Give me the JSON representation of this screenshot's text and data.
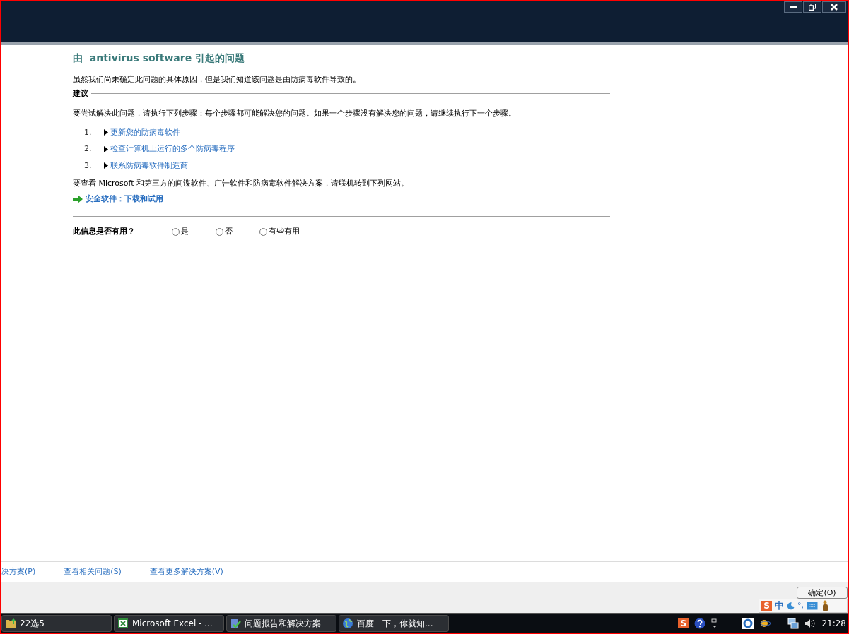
{
  "content": {
    "title": "由  antivirus software 引起的问题",
    "intro": "虽然我们尚未确定此问题的具体原因，但是我们知道该问题是由防病毒软件导致的。",
    "section_heading": "建议",
    "instructions": "要尝试解决此问题，请执行下列步骤：每个步骤都可能解决您的问题。如果一个步骤没有解决您的问题，请继续执行下一个步骤。",
    "steps": [
      {
        "number": "1.",
        "label": "更新您的防病毒软件"
      },
      {
        "number": "2.",
        "label": "检查计算机上运行的多个防病毒程序"
      },
      {
        "number": "3.",
        "label": "联系防病毒软件制造商"
      }
    ],
    "online_note": "要查看 Microsoft 和第三方的间谍软件、广告软件和防病毒软件解决方案，请联机转到下列网站。",
    "online_link": "安全软件：下载和试用",
    "feedback": {
      "question": "此信息是否有用？",
      "options": [
        {
          "label": "是",
          "selected": false
        },
        {
          "label": "否",
          "selected": false
        },
        {
          "label": "有些有用",
          "selected": false
        }
      ]
    }
  },
  "bottom_links": [
    "决方案(P)",
    "查看相关问题(S)",
    "查看更多解决方案(V)"
  ],
  "ok_button": "确定(O)",
  "ime_bar": {
    "logo": "S",
    "mode": "中",
    "punctuation": "°,"
  },
  "taskbar": {
    "items": [
      {
        "label": "22选5",
        "kind": "folder"
      },
      {
        "label": "Microsoft Excel - ...",
        "kind": "excel"
      },
      {
        "label": "问题报告和解决方案",
        "kind": "report"
      },
      {
        "label": "百度一下，你就知...",
        "kind": "globe"
      }
    ],
    "tray_logo": "S",
    "clock": "21:28"
  }
}
